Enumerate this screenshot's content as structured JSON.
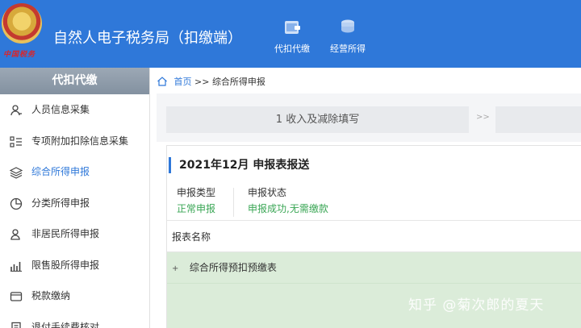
{
  "header": {
    "logo_text": "中国税务",
    "title": "自然人电子税务局（扣缴端）",
    "nav": [
      {
        "label": "代扣代缴",
        "icon": "wallet-icon"
      },
      {
        "label": "经营所得",
        "icon": "coins-icon"
      }
    ]
  },
  "sidebar": {
    "heading": "代扣代缴",
    "items": [
      {
        "label": "人员信息采集",
        "icon": "person-icon"
      },
      {
        "label": "专项附加扣除信息采集",
        "icon": "list-icon"
      },
      {
        "label": "综合所得申报",
        "icon": "layers-icon",
        "active": true
      },
      {
        "label": "分类所得申报",
        "icon": "pie-icon"
      },
      {
        "label": "非居民所得申报",
        "icon": "person-outline-icon"
      },
      {
        "label": "限售股所得申报",
        "icon": "bar-chart-icon"
      },
      {
        "label": "税款缴纳",
        "icon": "wallet-outline-icon"
      },
      {
        "label": "退付手续费核对",
        "icon": "receipt-icon"
      }
    ]
  },
  "breadcrumb": {
    "home": "首页",
    "separator": ">>",
    "current": "综合所得申报"
  },
  "steps": {
    "step1": "1 收入及减除填写",
    "arrow": ">>"
  },
  "report": {
    "title": "2021年12月  申报表报送",
    "type_label": "申报类型",
    "type_value": "正常申报",
    "status_label": "申报状态",
    "status_value": "申报成功,无需缴款",
    "table_header": "报表名称",
    "rows": [
      {
        "expand": "+",
        "name": "综合所得预扣预缴表"
      }
    ]
  },
  "watermark": "知乎 @菊次郎的夏天",
  "colors": {
    "brand_blue": "#2f78d9",
    "success_green": "#3aa655",
    "row_green": "#dbecd9"
  }
}
